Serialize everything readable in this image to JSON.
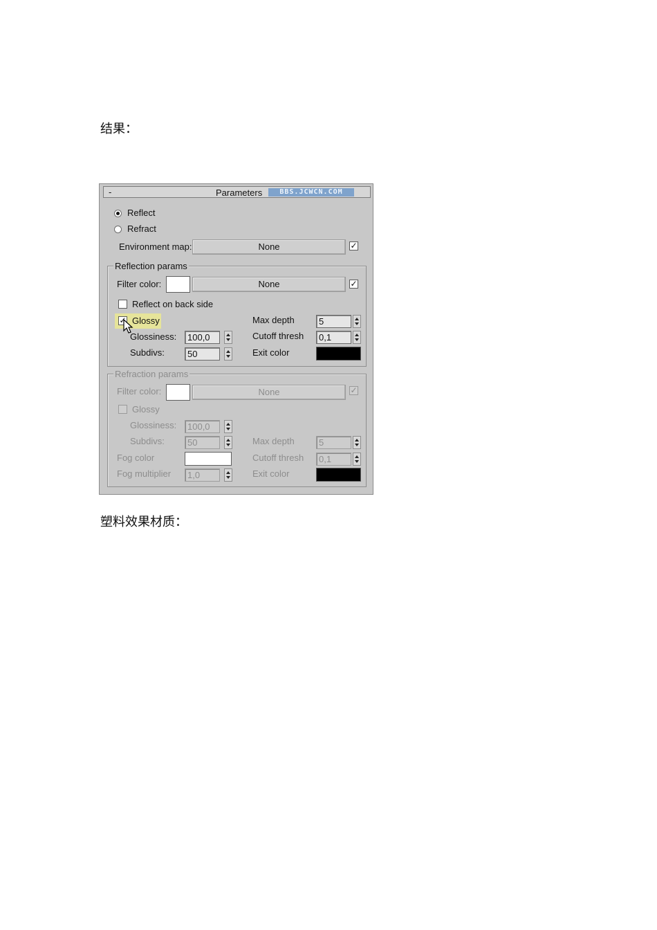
{
  "doc": {
    "heading_1": "结果：",
    "heading_2": "塑料效果材质："
  },
  "dialog": {
    "rollout_toggle": "-",
    "rollout_title": "Parameters",
    "watermark": "BBS.JCWCN.COM",
    "mode": {
      "reflect_label": "Reflect",
      "refract_label": "Refract",
      "selected": "Reflect"
    },
    "environment_map": {
      "label": "Environment map:",
      "button": "None",
      "checked": true
    },
    "reflection": {
      "group_label": "Reflection params",
      "filter_color_label": "Filter color:",
      "filter_color": "#ffffff",
      "filter_button": "None",
      "filter_checked": true,
      "reflect_back_label": "Reflect on back side",
      "glossy_label": "Glossy",
      "glossy_checked": true,
      "glossiness_label": "Glossiness:",
      "glossiness": "100,0",
      "subdivs_label": "Subdivs:",
      "subdivs": "50",
      "max_depth_label": "Max depth",
      "max_depth": "5",
      "cutoff_label": "Cutoff thresh",
      "cutoff": "0,1",
      "exit_color_label": "Exit color",
      "exit_color": "#000000"
    },
    "refraction": {
      "group_label": "Refraction params",
      "filter_color_label": "Filter color:",
      "filter_color": "#ffffff",
      "filter_button": "None",
      "filter_checked": true,
      "glossy_label": "Glossy",
      "glossiness_label": "Glossiness:",
      "glossiness": "100,0",
      "subdivs_label": "Subdivs:",
      "subdivs": "50",
      "max_depth_label": "Max depth",
      "max_depth": "5",
      "fog_color_label": "Fog color",
      "fog_color": "#ffffff",
      "cutoff_label": "Cutoff thresh",
      "cutoff": "0,1",
      "fog_multiplier_label": "Fog multiplier",
      "fog_multiplier": "1,0",
      "exit_color_label": "Exit color",
      "exit_color": "#000000"
    },
    "check_glyph": "✓"
  }
}
